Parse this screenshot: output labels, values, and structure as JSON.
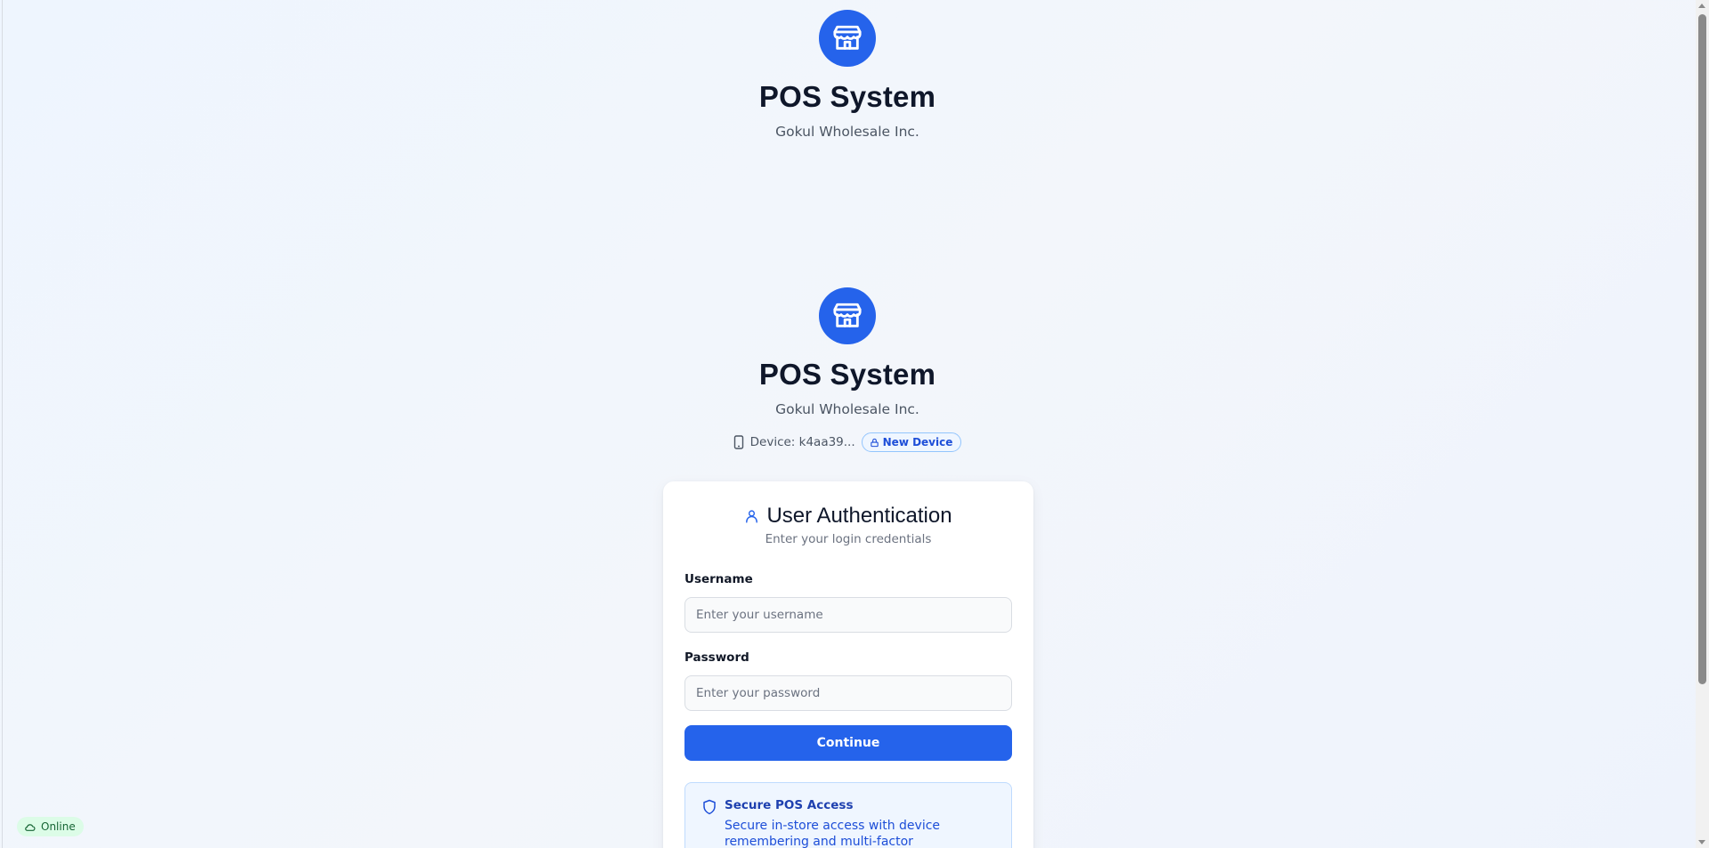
{
  "brand": {
    "title": "POS System",
    "company": "Gokul Wholesale Inc.",
    "logo_icon": "store-icon",
    "accent_color": "#2563eb"
  },
  "device": {
    "label": "Device: k4aa39...",
    "badge": "New Device",
    "device_icon": "smartphone-icon",
    "badge_icon": "lock-icon"
  },
  "auth": {
    "title": "User Authentication",
    "title_icon": "user-icon",
    "subtitle": "Enter your login credentials",
    "username_label": "Username",
    "username_placeholder": "Enter your username",
    "username_value": "",
    "password_label": "Password",
    "password_placeholder": "Enter your password",
    "password_value": "",
    "continue_label": "Continue"
  },
  "info": {
    "icon": "shield-icon",
    "title": "Secure POS Access",
    "text": "Secure in-store access with device remembering and multi-factor authentication for enhanced"
  },
  "status": {
    "label": "Online",
    "icon": "cloud-icon",
    "color": "#166534"
  }
}
